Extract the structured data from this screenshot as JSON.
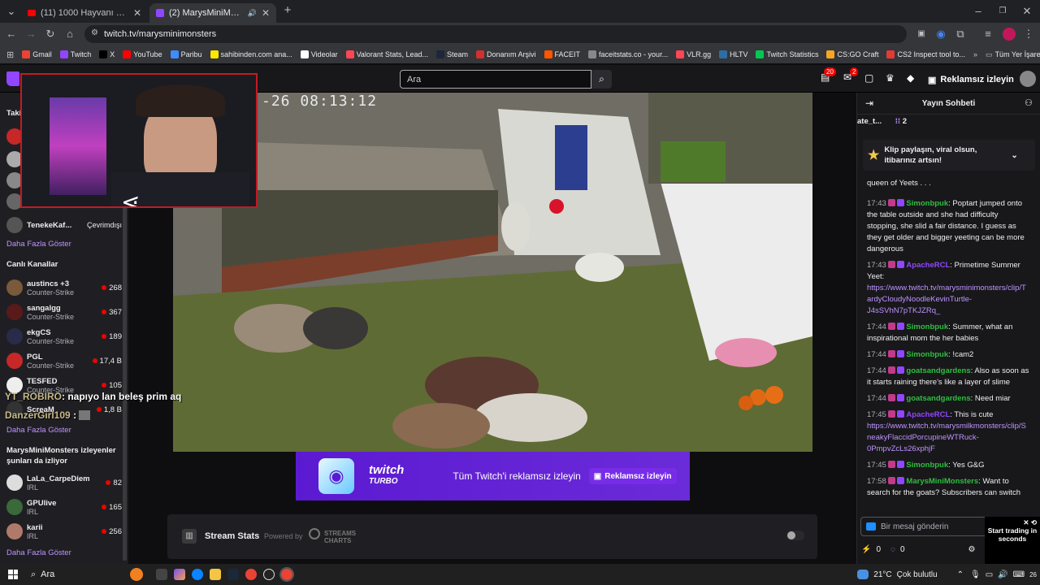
{
  "browser": {
    "tabs": [
      {
        "title": "(11) 1000 Hayvanı Ölümden Ku"
      },
      {
        "title": "(2) MarysMiniMonsters - Tw"
      }
    ],
    "url": "twitch.tv/marysminimonsters",
    "bookmarks": [
      {
        "label": "Gmail",
        "color": "#ea4335"
      },
      {
        "label": "Twitch",
        "color": "#9146ff"
      },
      {
        "label": "X",
        "color": "#000000"
      },
      {
        "label": "YouTube",
        "color": "#ff0000"
      },
      {
        "label": "Paribu",
        "color": "#3f8cff"
      },
      {
        "label": "sahibinden.com ana...",
        "color": "#ffe800"
      },
      {
        "label": "Videolar",
        "color": "#ffffff"
      },
      {
        "label": "Valorant Stats, Lead...",
        "color": "#ff4655"
      },
      {
        "label": "Steam",
        "color": "#1b2838"
      },
      {
        "label": "Donanım Arşivi",
        "color": "#d32f2f"
      },
      {
        "label": "FACEIT",
        "color": "#ff5500"
      },
      {
        "label": "faceitstats.co - your...",
        "color": "#888888"
      },
      {
        "label": "VLR.gg",
        "color": "#ff4655"
      },
      {
        "label": "HLTV",
        "color": "#2d6da3"
      },
      {
        "label": "Twitch Statistics",
        "color": "#00c853"
      },
      {
        "label": "CS:GO Craft",
        "color": "#f5a623"
      },
      {
        "label": "CS2 Inspect tool to...",
        "color": "#e53935"
      }
    ],
    "all_bookmarks": "Tüm Yer İşaretleri"
  },
  "topnav": {
    "search_placeholder": "Ara",
    "notif_count": "20",
    "inbox_count": "2",
    "adfree_label": "Reklamsız izleyin"
  },
  "sidebar": {
    "following_header": "Taki",
    "offline_user": {
      "name": "TenekeKaf...",
      "status": "Çevrimdışı"
    },
    "show_more_1": "Daha Fazla Göster",
    "live_header": "Canlı Kanallar",
    "live": [
      {
        "name": "austincs +3",
        "game": "Counter-Strike",
        "viewers": "268",
        "color": "#7a5a3a"
      },
      {
        "name": "sangalgg",
        "game": "Counter-Strike",
        "viewers": "367",
        "color": "#5a1a1a"
      },
      {
        "name": "ekgCS",
        "game": "Counter-Strike",
        "viewers": "189",
        "color": "#2a2a4a"
      },
      {
        "name": "PGL",
        "game": "Counter-Strike",
        "viewers": "17,4 B",
        "color": "#c62828"
      },
      {
        "name": "TESFED",
        "game": "Counter-Strike",
        "viewers": "105",
        "color": "#eeeeee"
      },
      {
        "name": "ScreaM",
        "game": "",
        "viewers": "1,8 B",
        "color": "#333333"
      }
    ],
    "show_more_2": "Daha Fazla Göster",
    "also_watch_header": "MarysMiniMonsters izleyenler şunları da izliyor",
    "also_watch": [
      {
        "name": "LaLa_CarpeDiem",
        "game": "IRL",
        "viewers": "82",
        "color": "#dddddd"
      },
      {
        "name": "GPUlive",
        "game": "IRL",
        "viewers": "165",
        "color": "#3a6a3a"
      },
      {
        "name": "karii",
        "game": "IRL",
        "viewers": "256",
        "color": "#b07a6a"
      }
    ],
    "show_more_3": "Daha Fazla Göster"
  },
  "overlay": {
    "cam_timestamp": "-26 08:13:12",
    "donation_1_user": "YT_ROBIRO",
    "donation_1_text": ": napıyo lan beleş prim aq",
    "donation_2_user": "DanzerGirl109",
    "donation_2_text": ":"
  },
  "ad": {
    "brand": "twitch",
    "product": "TURBO",
    "text": "Tüm Twitch'i reklamsız izleyin",
    "button": "Reklamsız izleyin"
  },
  "stream_stats": {
    "title": "Stream Stats",
    "powered_by": "Powered by",
    "provider_line1": "STREAMS",
    "provider_line2": "CHARTS"
  },
  "chat": {
    "header": "Yayın Sohbeti",
    "channel_partial": "ate_t...",
    "viewer_count": "2",
    "pinned": "Klip paylaşın, viral olsun, itibarınız artsın!",
    "partial_message": "queen of Yeets . . .",
    "messages": [
      {
        "time": "17:43",
        "user": "Simonbpuk",
        "color": "#2fbf3f",
        "text": ": Poptart jumped onto the table outside and she had difficulty stopping, she slid a fair distance. I guess as they get older and bigger yeeting can be more dangerous",
        "link": ""
      },
      {
        "time": "17:43",
        "user": "ApacheRCL",
        "color": "#9146ff",
        "text": ": Primetime Summer Yeet:",
        "link": "https://www.twitch.tv/marysminimonsters/clip/TardyCloudyNoodleKevinTurtle-J4sSVhN7pTKJZRq_"
      },
      {
        "time": "17:44",
        "user": "Simonbpuk",
        "color": "#2fbf3f",
        "text": ": Summer, what an inspirational mom the her babies",
        "link": ""
      },
      {
        "time": "17:44",
        "user": "Simonbpuk",
        "color": "#2fbf3f",
        "text": ": !cam2",
        "link": ""
      },
      {
        "time": "17:44",
        "user": "goatsandgardens",
        "color": "#2fbf3f",
        "text": ": Also as soon as it starts raining there's like a layer of slime",
        "link": ""
      },
      {
        "time": "17:44",
        "user": "goatsandgardens",
        "color": "#2fbf3f",
        "text": ": Need miar",
        "link": ""
      },
      {
        "time": "17:45",
        "user": "ApacheRCL",
        "color": "#9146ff",
        "text": ": This is cute",
        "link": "https://www.twitch.tv/marysmilkmonsters/clip/SneakyFlaccidPorcupineWTRuck-0PmpvZcLs26xphjF"
      },
      {
        "time": "17:45",
        "user": "Simonbpuk",
        "color": "#2fbf3f",
        "text": ": Yes G&G",
        "link": ""
      },
      {
        "time": "17:58",
        "user": "MarysMiniMonsters",
        "color": "#2fbf3f",
        "text": ": Want to search for the goats? Subscribers can switch",
        "link": ""
      }
    ],
    "input_placeholder": "Bir mesaj gönderin",
    "points": "0",
    "bits": "0",
    "trading_ad": "Start trading in seconds"
  },
  "taskbar": {
    "search": "Ara",
    "weather_temp": "21°C",
    "weather_text": "Çok bulutlu",
    "clock_partial": "26"
  }
}
